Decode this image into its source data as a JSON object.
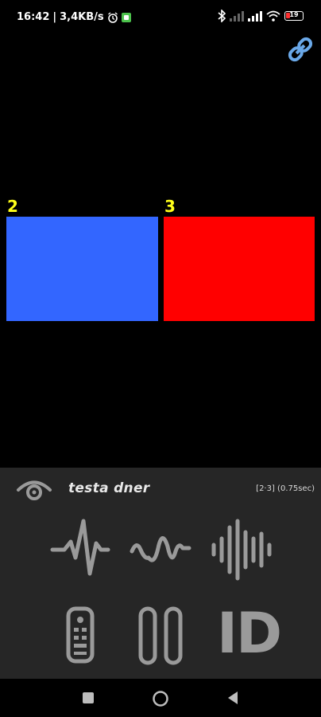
{
  "status_bar": {
    "time": "16:42",
    "speed": "3,4KB/s",
    "battery": "19"
  },
  "tiles": [
    {
      "label": "2",
      "color": "#3366ff"
    },
    {
      "label": "3",
      "color": "#ff0000"
    }
  ],
  "panel": {
    "title": "testa dner",
    "info": "[2·3] (0.75sec)",
    "icons": {
      "waveform_1": "heartbeat-wave-icon",
      "waveform_2": "sine-wave-icon",
      "waveform_3": "audio-bars-icon",
      "remote": "remote-control-icon",
      "pause": "pause-icon"
    },
    "id_label": "ID"
  },
  "colors": {
    "background": "#000000",
    "panel": "#262626",
    "icon_gray": "#9a9a9a",
    "label_yellow": "#ffff1a",
    "link_blue": "#6aa8e8"
  }
}
